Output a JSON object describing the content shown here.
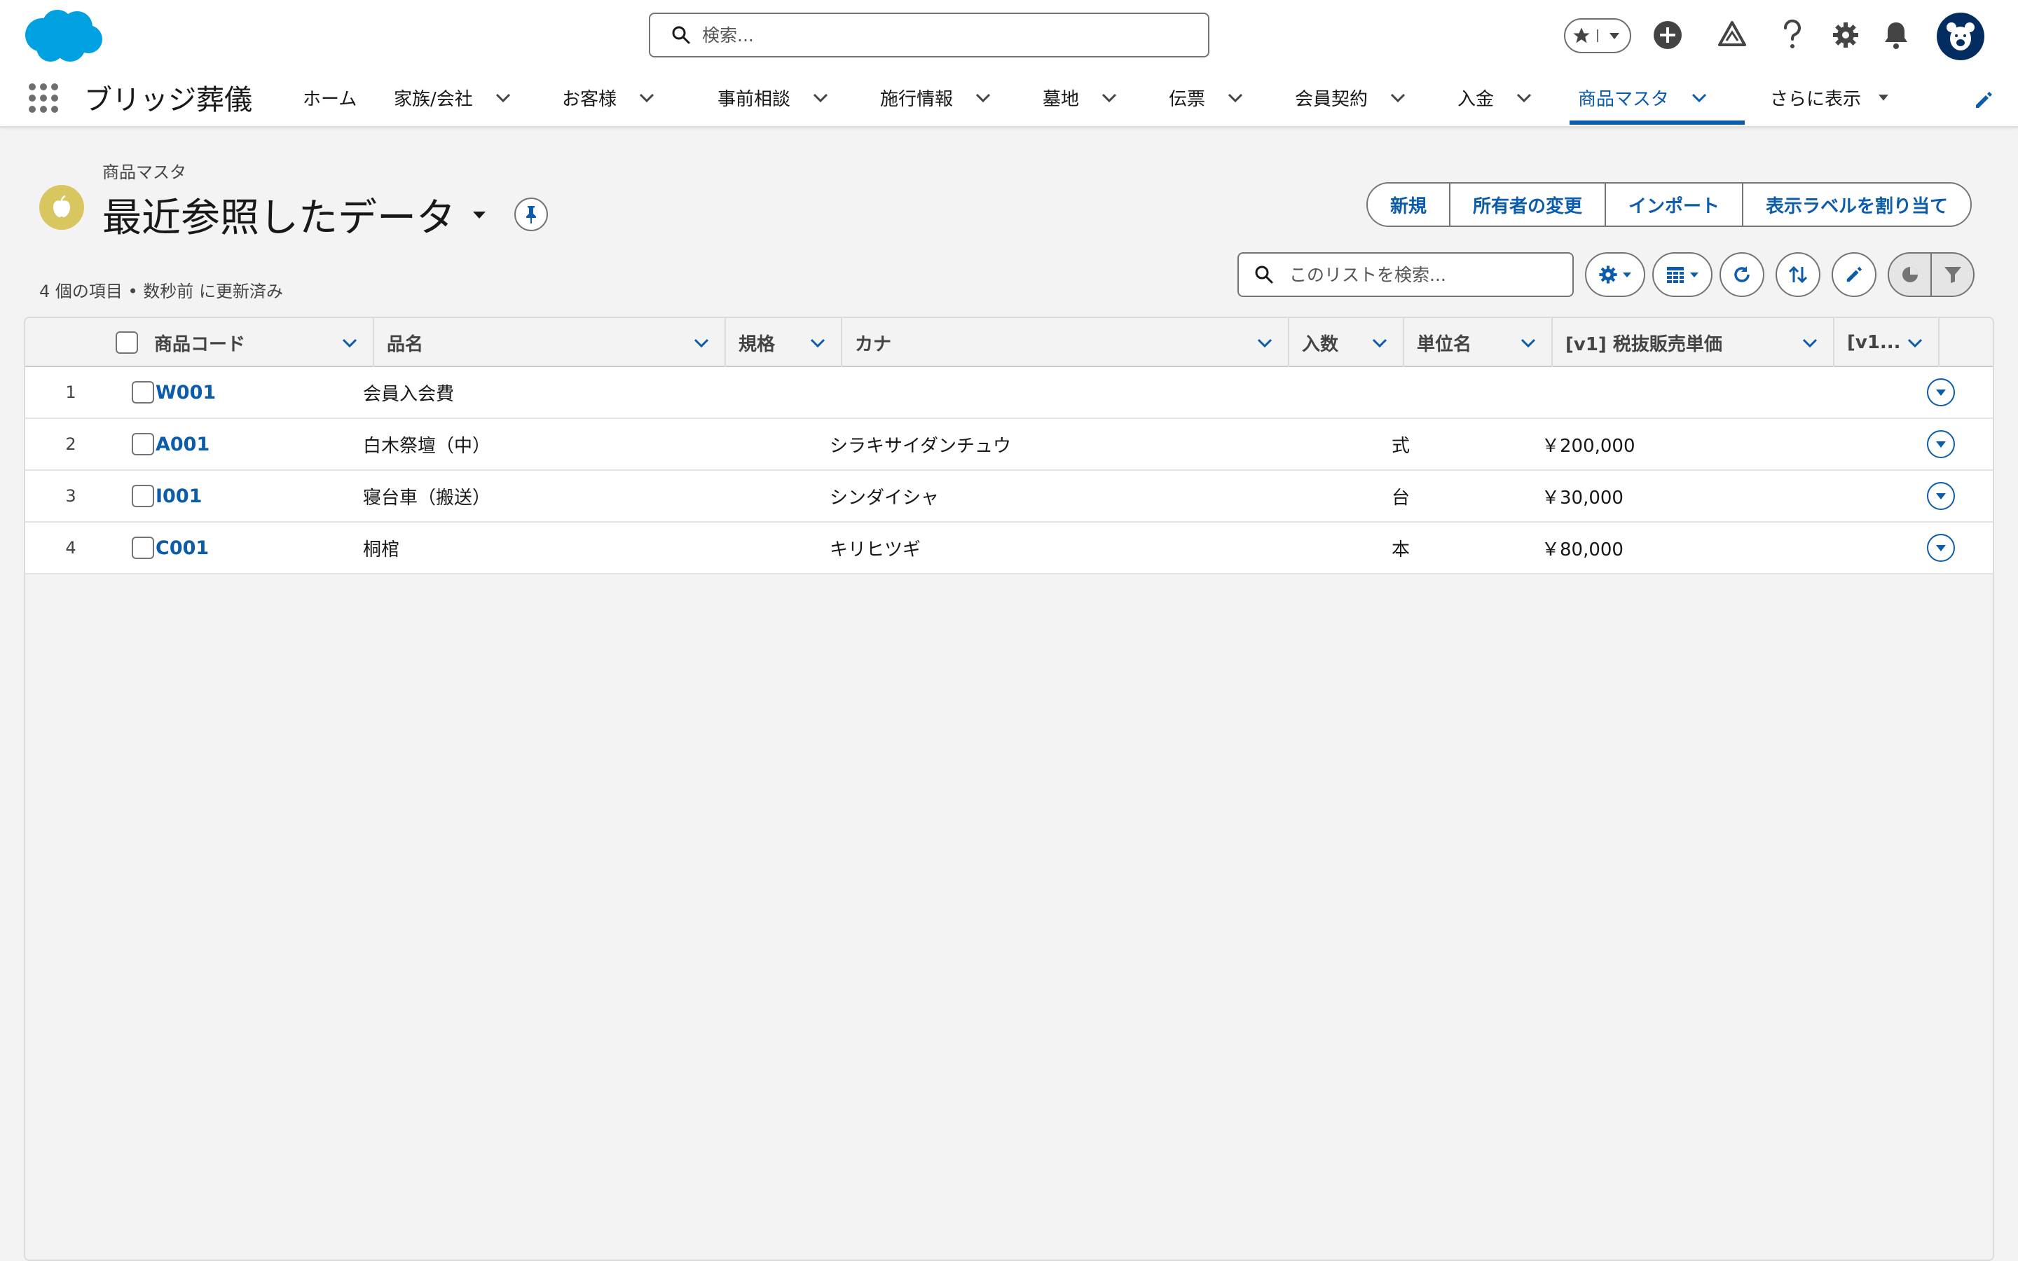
{
  "header": {
    "search_placeholder": "検索..."
  },
  "nav": {
    "app_name": "ブリッジ葬儀",
    "items": [
      {
        "label": "ホーム"
      },
      {
        "label": "家族/会社"
      },
      {
        "label": "お客様"
      },
      {
        "label": "事前相談"
      },
      {
        "label": "施行情報"
      },
      {
        "label": "墓地"
      },
      {
        "label": "伝票"
      },
      {
        "label": "会員契約"
      },
      {
        "label": "入金"
      },
      {
        "label": "商品マスタ"
      },
      {
        "label": "さらに表示"
      }
    ]
  },
  "page": {
    "object_label": "商品マスタ",
    "list_view_title": "最近参照したデータ",
    "item_count_text": "4 個の項目 • 数秒前 に更新済み",
    "actions": {
      "new": "新規",
      "change_owner": "所有者の変更",
      "import": "インポート",
      "assign_label": "表示ラベルを割り当て"
    },
    "list_search_placeholder": "このリストを検索..."
  },
  "table": {
    "columns": {
      "code": "商品コード",
      "name": "品名",
      "spec": "規格",
      "kana": "カナ",
      "qty": "入数",
      "unit": "単位名",
      "price": "[v1] 税抜販売単価",
      "more": "[v1..."
    },
    "rows": [
      {
        "num": "1",
        "code": "W001",
        "name": "会員入会費",
        "spec": "",
        "kana": "",
        "qty": "",
        "unit": "",
        "price": ""
      },
      {
        "num": "2",
        "code": "A001",
        "name": "白木祭壇（中）",
        "spec": "",
        "kana": "シラキサイダンチュウ",
        "qty": "",
        "unit": "式",
        "price": "￥200,000"
      },
      {
        "num": "3",
        "code": "I001",
        "name": "寝台車（搬送）",
        "spec": "",
        "kana": "シンダイシャ",
        "qty": "",
        "unit": "台",
        "price": "￥30,000"
      },
      {
        "num": "4",
        "code": "C001",
        "name": "桐棺",
        "spec": "",
        "kana": "キリヒツギ",
        "qty": "",
        "unit": "本",
        "price": "￥80,000"
      }
    ]
  },
  "colors": {
    "brand_blue": "#0b5cab",
    "cloud_blue": "#00a1e0",
    "object_icon": "#d8c760"
  }
}
